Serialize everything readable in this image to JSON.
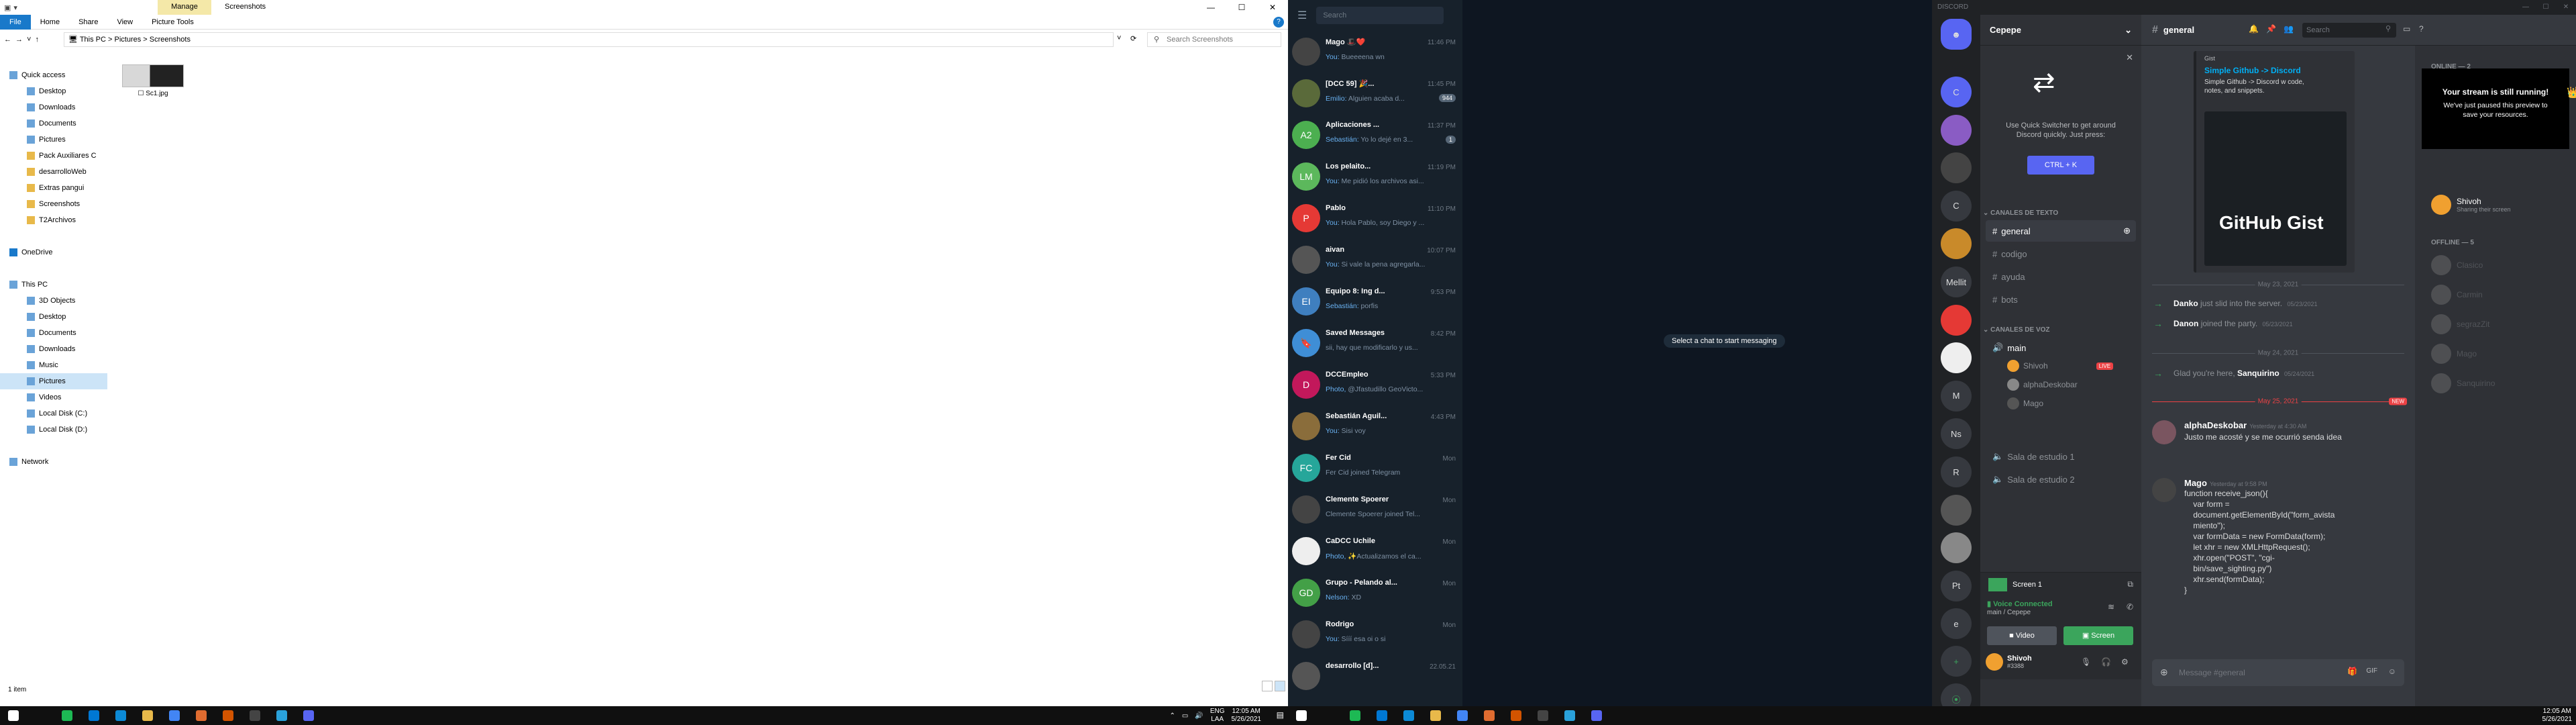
{
  "explorer": {
    "manage_tab": "Manage",
    "window_title": "Screenshots",
    "tabs": [
      "File",
      "Home",
      "Share",
      "View",
      "Picture Tools"
    ],
    "breadcrumb": [
      "This PC",
      "Pictures",
      "Screenshots"
    ],
    "search_placeholder": "Search Screenshots",
    "nav": [
      {
        "label": "Quick access",
        "level": 0,
        "icon": "star-icon"
      },
      {
        "label": "Desktop",
        "level": 1,
        "icon": "desktop-icon"
      },
      {
        "label": "Downloads",
        "level": 1,
        "icon": "download-icon"
      },
      {
        "label": "Documents",
        "level": 1,
        "icon": "documents-icon"
      },
      {
        "label": "Pictures",
        "level": 1,
        "icon": "pictures-icon"
      },
      {
        "label": "Pack Auxiliares C",
        "level": 1,
        "icon": "folder-icon"
      },
      {
        "label": "desarrolloWeb",
        "level": 1,
        "icon": "folder-icon"
      },
      {
        "label": "Extras pangui",
        "level": 1,
        "icon": "folder-icon"
      },
      {
        "label": "Screenshots",
        "level": 1,
        "icon": "folder-icon"
      },
      {
        "label": "T2Archivos",
        "level": 1,
        "icon": "folder-icon"
      },
      {
        "label": "",
        "level": -1
      },
      {
        "label": "OneDrive",
        "level": 0,
        "icon": "cloud-icon"
      },
      {
        "label": "",
        "level": -1
      },
      {
        "label": "This PC",
        "level": 0,
        "icon": "pc-icon"
      },
      {
        "label": "3D Objects",
        "level": 1,
        "icon": "cube-icon"
      },
      {
        "label": "Desktop",
        "level": 1,
        "icon": "desktop-icon"
      },
      {
        "label": "Documents",
        "level": 1,
        "icon": "documents-icon"
      },
      {
        "label": "Downloads",
        "level": 1,
        "icon": "download-icon"
      },
      {
        "label": "Music",
        "level": 1,
        "icon": "music-icon"
      },
      {
        "label": "Pictures",
        "level": 1,
        "icon": "pictures-icon",
        "selected": true
      },
      {
        "label": "Videos",
        "level": 1,
        "icon": "video-icon"
      },
      {
        "label": "Local Disk (C:)",
        "level": 1,
        "icon": "disk-icon"
      },
      {
        "label": "Local Disk (D:)",
        "level": 1,
        "icon": "disk-icon"
      },
      {
        "label": "",
        "level": -1
      },
      {
        "label": "Network",
        "level": 0,
        "icon": "network-icon"
      }
    ],
    "file_name": "Sc1.jpg",
    "status": "1 item"
  },
  "telegram": {
    "search_placeholder": "Search",
    "empty_message": "Select a chat to start messaging",
    "chats": [
      {
        "name": "Mago 🎩❤️",
        "time": "11:46 PM",
        "msg_prefix": "You:",
        "msg": " Bueeeena wn",
        "avatar_color": "#444",
        "initials": ""
      },
      {
        "name": "[DCC 59] 🎉...",
        "time": "11:45 PM",
        "msg_prefix": "Emilio:",
        "msg": " Alguien acaba d...",
        "badge": "944",
        "avatar_color": "#5a6a3a",
        "initials": ""
      },
      {
        "name": "Aplicaciones ...",
        "time": "11:37 PM",
        "msg_prefix": "Sebastián:",
        "msg": " Yo lo dejé en 3...",
        "badge": "1",
        "avatar_color": "#4caf50",
        "initials": "A2"
      },
      {
        "name": "Los pelaito...",
        "time": "11:19 PM",
        "msg_prefix": "You:",
        "msg": " Me pidió los archivos asi...",
        "avatar_color": "#5cb85c",
        "initials": "LM"
      },
      {
        "name": "Pablo",
        "time": "11:10 PM",
        "msg_prefix": "You:",
        "msg": " Hola Pablo, soy Diego y ...",
        "avatar_color": "#e53935",
        "initials": "P"
      },
      {
        "name": "aivan",
        "time": "10:07 PM",
        "msg_prefix": "You:",
        "msg": " Si vale la pena agregarla...",
        "avatar_color": "#555",
        "initials": ""
      },
      {
        "name": "Equipo 8: Ing d...",
        "time": "9:53 PM",
        "msg_prefix": "Sebastián:",
        "msg": " porfis",
        "avatar_color": "#3f7fbf",
        "initials": "EI"
      },
      {
        "name": "Saved Messages",
        "time": "8:42 PM",
        "msg_prefix": "",
        "msg": "sii, hay que modificarlo y us...",
        "avatar_color": "#3f8ed6",
        "initials": "🔖"
      },
      {
        "name": "DCCEmpleo",
        "time": "5:33 PM",
        "msg_prefix": "Photo,",
        "msg": " @Jfastudillo GeoVicto...",
        "avatar_color": "#c2185b",
        "initials": "D"
      },
      {
        "name": "Sebastián Aguil...",
        "time": "4:43 PM",
        "msg_prefix": "You:",
        "msg": " Sisi voy",
        "avatar_color": "#8a6d3b",
        "initials": ""
      },
      {
        "name": "Fer Cid",
        "time": "Mon",
        "msg_prefix": "",
        "msg": "Fer Cid joined Telegram",
        "avatar_color": "#26a69a",
        "initials": "FC"
      },
      {
        "name": "Clemente Spoerer",
        "time": "Mon",
        "msg_prefix": "",
        "msg": "Clemente Spoerer joined Tel...",
        "avatar_color": "#444",
        "initials": ""
      },
      {
        "name": "CaDCC Uchile",
        "time": "Mon",
        "msg_prefix": "Photo,",
        "msg": " ✨Actualizamos el ca...",
        "avatar_color": "#eee",
        "initials": ""
      },
      {
        "name": "Grupo - Pelando al...",
        "time": "Mon",
        "msg_prefix": "Nelson:",
        "msg": " XD",
        "avatar_color": "#43a047",
        "initials": "GD"
      },
      {
        "name": "Rodrigo",
        "time": "Mon",
        "msg_prefix": "You:",
        "msg": " Sííí esa oi o si",
        "avatar_color": "#444",
        "initials": ""
      },
      {
        "name": "desarrollo [d]...",
        "time": "22.05.21",
        "msg_prefix": "",
        "msg": "",
        "avatar_color": "#555",
        "initials": ""
      }
    ]
  },
  "discord": {
    "app_title": "DISCORD",
    "guild": "Cepepe",
    "channel": "general",
    "search_placeholder": "Search",
    "quick_switcher": {
      "text": "Use Quick Switcher to get around Discord quickly. Just press:",
      "shortcut": "CTRL + K"
    },
    "text_category": "CANALES DE TEXTO",
    "text_channels": [
      "general",
      "codigo",
      "ayuda",
      "bots"
    ],
    "voice_category": "CANALES DE VOZ",
    "voice_channels": [
      "main",
      "Sala de estudio 1",
      "Sala de estudio 2"
    ],
    "voice_users": [
      "Shivoh",
      "alphaDeskobar",
      "Mago"
    ],
    "live_badge": "LIVE",
    "screen_label": "Screen 1",
    "voice_status": "Voice Connected",
    "voice_sub": "main / Cepepe",
    "btn_video": "Video",
    "btn_screen": "Screen",
    "user": {
      "name": "Shivoh",
      "tag": "#3388"
    },
    "servers": [
      "C",
      "",
      "",
      "C",
      "",
      "Mellit",
      "",
      "",
      "M",
      "Ns",
      "R",
      "",
      "",
      "Pt",
      "e"
    ],
    "embed": {
      "site": "Gist",
      "title": "Simple Github -> Discord",
      "desc": "Simple Github -> Discord w code, notes, and snippets.",
      "logo_text": "GitHub Gist"
    },
    "dates": [
      "May 23, 2021",
      "May 24, 2021",
      "May 25, 2021"
    ],
    "new_badge": "NEW",
    "system": [
      {
        "user": "Danko",
        "text": "just slid into the server.",
        "ts": "05/23/2021"
      },
      {
        "user": "Danon",
        "text": "joined the party.",
        "ts": "05/23/2021"
      },
      {
        "user": "Sanquirino",
        "text": "Glad you're here,",
        "ts": "05/24/2021"
      }
    ],
    "messages": [
      {
        "author": "alphaDeskobar",
        "ts": "Yesterday at 4:30 AM",
        "lines": [
          "Justo me acosté y se me ocurrió senda idea"
        ]
      },
      {
        "author": "Mago",
        "ts": "Yesterday at 9:58 PM",
        "lines": [
          "function receive_json(){",
          "    var form =",
          "    document.getElementById(\"form_avista",
          "    miento\");",
          "    var formData = new FormData(form);",
          "    let xhr = new XMLHttpRequest();",
          "    xhr.open(\"POST\", \"cgi-",
          "    bin/save_sighting.py\")",
          "    xhr.send(formData);",
          "}"
        ]
      }
    ],
    "input_placeholder": "Message #general",
    "stream_banner": {
      "title": "Your stream is still running!",
      "text": "We've just paused this preview to save your resources."
    },
    "members": {
      "online_label": "ONLINE — 2",
      "offline_label": "OFFLINE — 5",
      "online": [
        {
          "name": "Shivoh",
          "status": "Sharing their screen"
        }
      ],
      "offline": [
        "Clasico",
        "Carmin",
        "segrazZit",
        "Mago",
        "Sanquirino"
      ]
    }
  },
  "taskbar_left": {
    "lang": "ENG",
    "lang2": "LAA",
    "time": "12:05 AM",
    "date": "5/26/2021"
  },
  "taskbar_right": {
    "time": "12:05 AM",
    "date": "5/26/2021"
  }
}
